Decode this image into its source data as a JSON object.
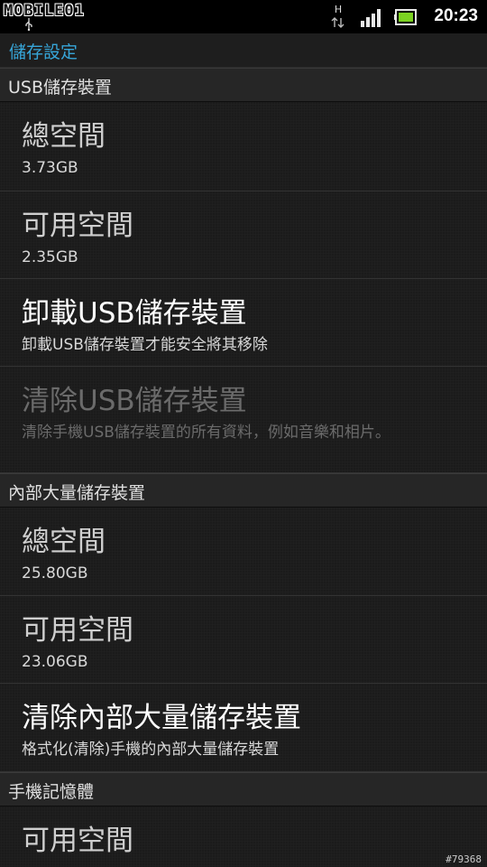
{
  "status_bar": {
    "watermark_text": "MOBILE01",
    "network_type": "H",
    "time": "20:23"
  },
  "title_bar": {
    "title": "儲存設定"
  },
  "sections": [
    {
      "header": "USB儲存裝置",
      "items": [
        {
          "title": "總空間",
          "summary": "3.73GB"
        },
        {
          "title": "可用空間",
          "summary": "2.35GB"
        },
        {
          "title": "卸載USB儲存裝置",
          "summary": "卸載USB儲存裝置才能安全將其移除"
        },
        {
          "title": "清除USB儲存裝置",
          "summary": "清除手機USB儲存裝置的所有資料，例如音樂和相片。"
        }
      ]
    },
    {
      "header": "內部大量儲存裝置",
      "items": [
        {
          "title": "總空間",
          "summary": "25.80GB"
        },
        {
          "title": "可用空間",
          "summary": "23.06GB"
        },
        {
          "title": "清除內部大量儲存裝置",
          "summary": "格式化(清除)手機的內部大量儲存裝置"
        }
      ]
    },
    {
      "header": "手機記憶體",
      "items": [
        {
          "title": "可用空間",
          "summary": ""
        }
      ]
    }
  ],
  "photo_id": "#79368",
  "colors": {
    "accent": "#37a6d9",
    "background": "#1b1b1b",
    "section_header": "#262626",
    "disabled_text": "#6b6b6b",
    "battery_green": "#7bd121"
  }
}
